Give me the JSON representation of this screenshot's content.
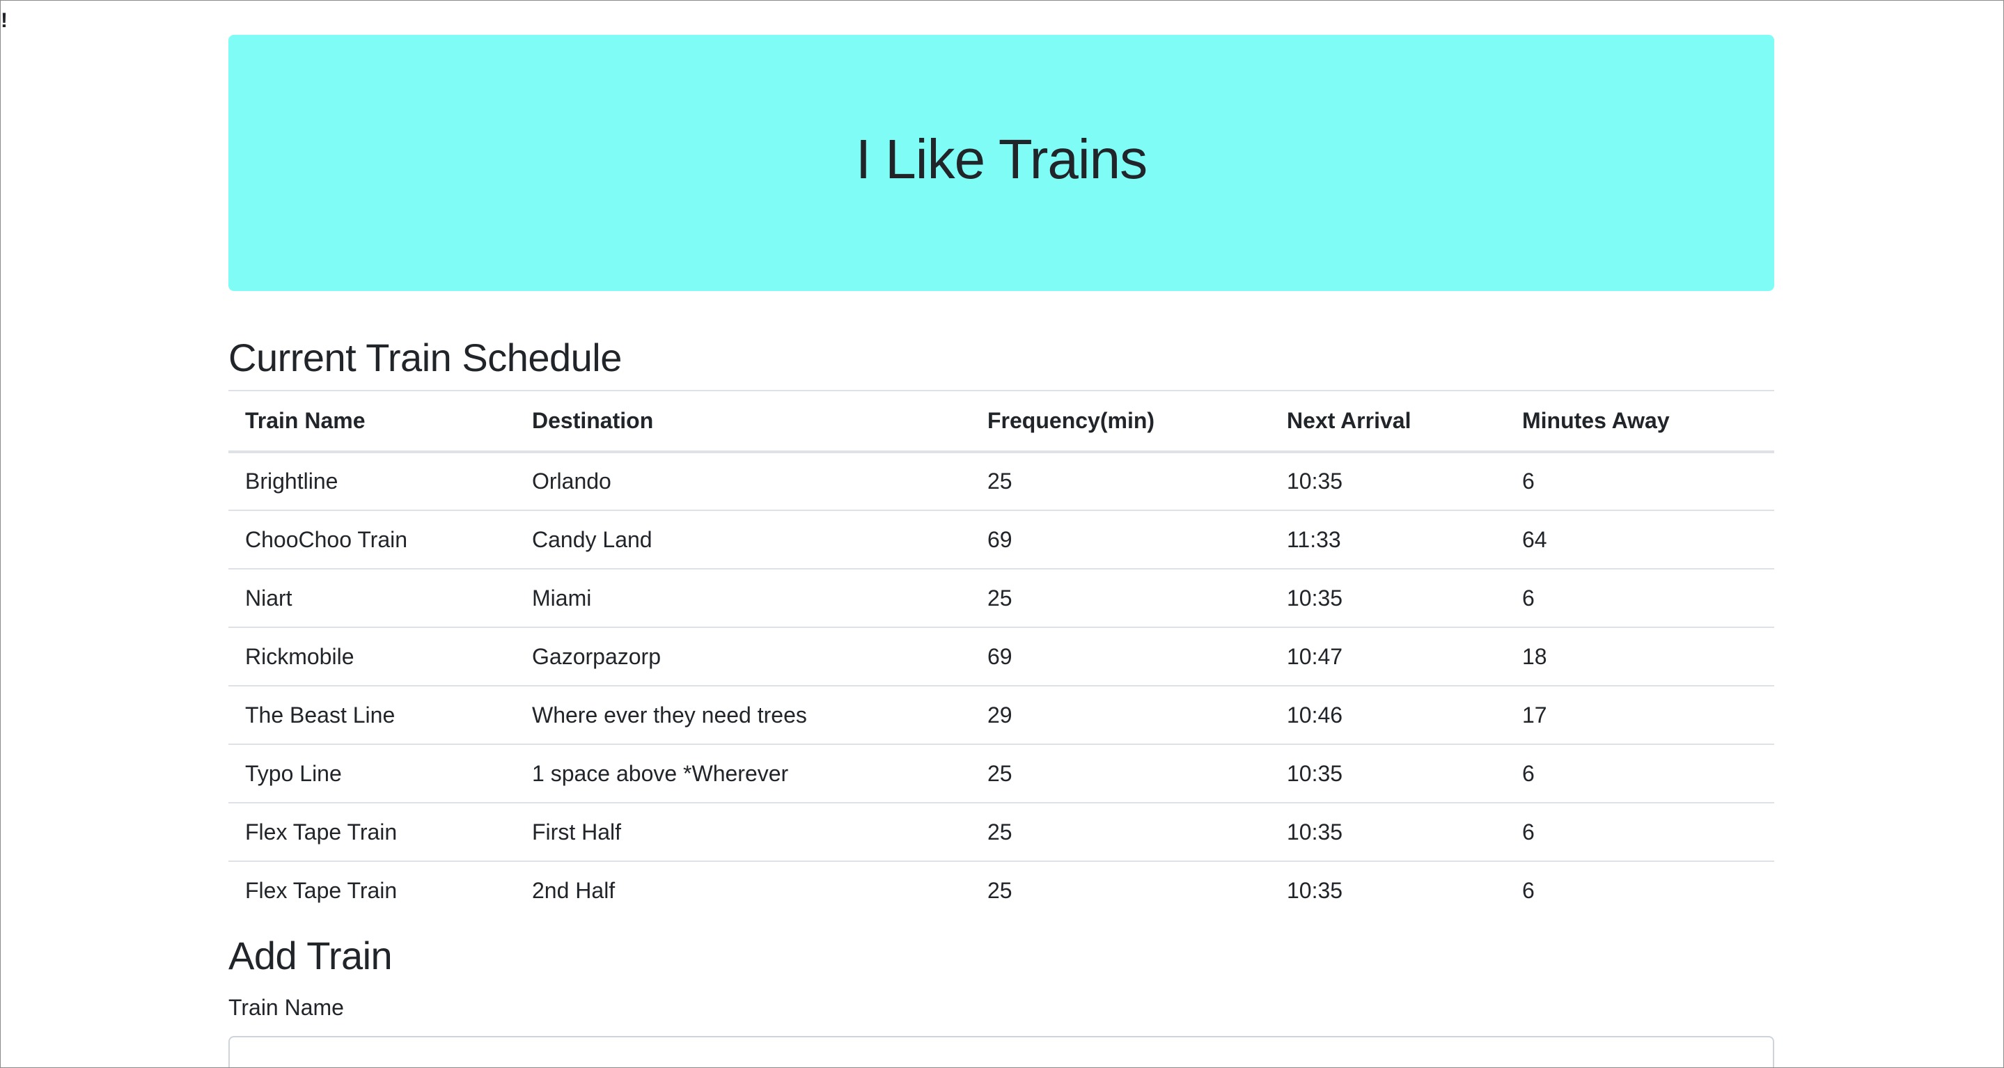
{
  "stray_mark": "!",
  "header": {
    "title": "I Like Trains",
    "background_color": "#7ffcf5"
  },
  "schedule": {
    "title": "Current Train Schedule",
    "columns": {
      "name": "Train Name",
      "destination": "Destination",
      "frequency": "Frequency(min)",
      "next_arrival": "Next Arrival",
      "minutes_away": "Minutes Away"
    },
    "rows": [
      {
        "name": "Brightline",
        "destination": "Orlando",
        "frequency": "25",
        "next_arrival": "10:35",
        "minutes_away": "6"
      },
      {
        "name": "ChooChoo Train",
        "destination": "Candy Land",
        "frequency": "69",
        "next_arrival": "11:33",
        "minutes_away": "64"
      },
      {
        "name": "Niart",
        "destination": "Miami",
        "frequency": "25",
        "next_arrival": "10:35",
        "minutes_away": "6"
      },
      {
        "name": "Rickmobile",
        "destination": "Gazorpazorp",
        "frequency": "69",
        "next_arrival": "10:47",
        "minutes_away": "18"
      },
      {
        "name": "The Beast Line",
        "destination": "Where ever they need trees",
        "frequency": "29",
        "next_arrival": "10:46",
        "minutes_away": "17"
      },
      {
        "name": "Typo Line",
        "destination": "1 space above *Wherever",
        "frequency": "25",
        "next_arrival": "10:35",
        "minutes_away": "6"
      },
      {
        "name": "Flex Tape Train",
        "destination": "First Half",
        "frequency": "25",
        "next_arrival": "10:35",
        "minutes_away": "6"
      },
      {
        "name": "Flex Tape Train",
        "destination": "2nd Half",
        "frequency": "25",
        "next_arrival": "10:35",
        "minutes_away": "6"
      }
    ]
  },
  "add_train": {
    "title": "Add Train",
    "train_name_label": "Train Name",
    "train_name_value": ""
  }
}
